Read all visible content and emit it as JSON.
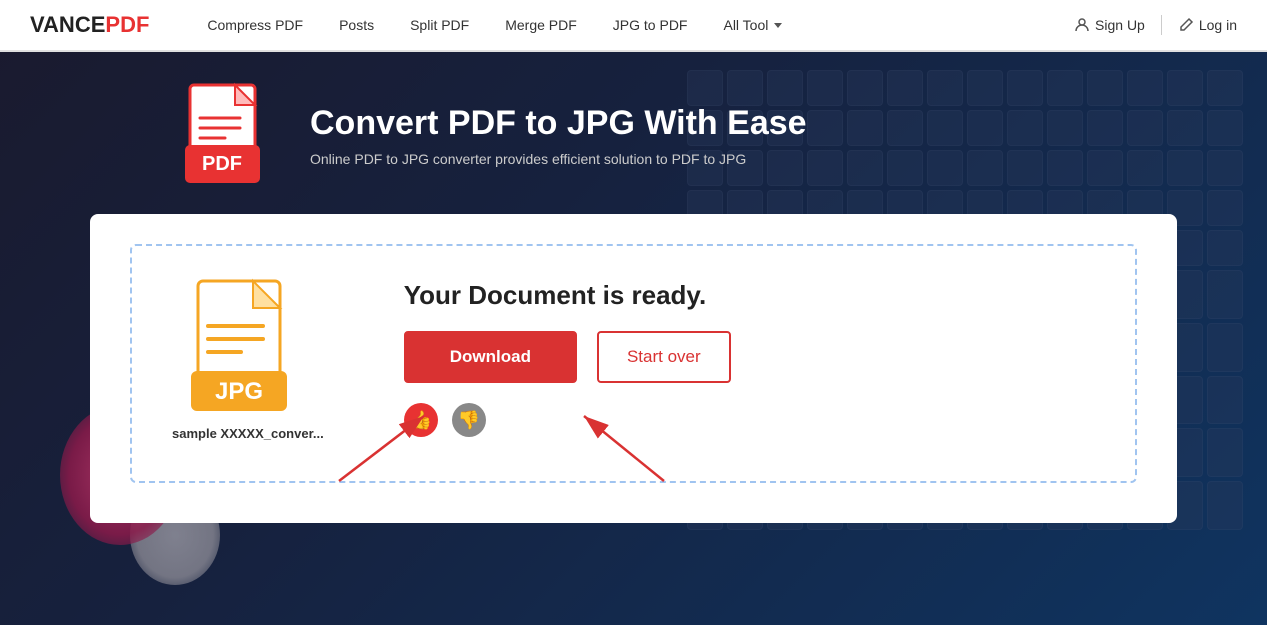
{
  "brand": {
    "name_vance": "VANCE",
    "name_pdf": "PDF"
  },
  "nav": {
    "links": [
      {
        "label": "Compress PDF",
        "id": "compress-pdf"
      },
      {
        "label": "Posts",
        "id": "posts"
      },
      {
        "label": "Split PDF",
        "id": "split-pdf"
      },
      {
        "label": "Merge PDF",
        "id": "merge-pdf"
      },
      {
        "label": "JPG to PDF",
        "id": "jpg-to-pdf"
      },
      {
        "label": "All Tool",
        "id": "all-tool",
        "has_dropdown": true
      }
    ],
    "signup_label": "Sign Up",
    "login_label": "Log in"
  },
  "hero": {
    "title": "Convert PDF to JPG With Ease",
    "subtitle": "Online PDF to JPG converter provides efficient solution to PDF to JPG"
  },
  "result": {
    "ready_text": "Your Document is ready.",
    "download_label": "Download",
    "startover_label": "Start over",
    "filename": "sample XXXXX_conver..."
  },
  "feedback": {
    "like_icon": "👍",
    "dislike_icon": "👎"
  },
  "colors": {
    "accent_red": "#d93232",
    "brand_orange": "#f5a623",
    "logo_pdf_red": "#e83232"
  }
}
